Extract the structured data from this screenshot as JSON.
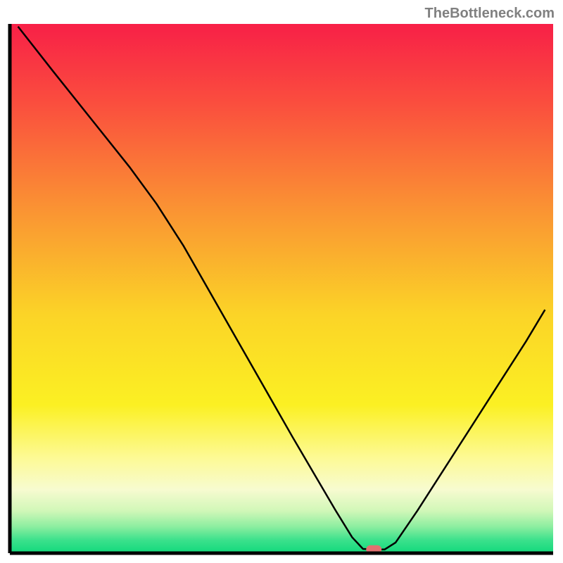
{
  "watermark": "TheBottleneck.com",
  "chart_data": {
    "type": "line",
    "title": "",
    "xlabel": "",
    "ylabel": "",
    "x_range": [
      0,
      100
    ],
    "y_range": [
      0,
      100
    ],
    "curve_description": "V-shaped bottleneck curve descending from top-left to minimum near x=67 then rising to right edge",
    "curve": [
      {
        "x": 1.5,
        "y": 99.5
      },
      {
        "x": 8,
        "y": 91
      },
      {
        "x": 15,
        "y": 82
      },
      {
        "x": 22,
        "y": 73
      },
      {
        "x": 27,
        "y": 66
      },
      {
        "x": 32,
        "y": 58
      },
      {
        "x": 37,
        "y": 49
      },
      {
        "x": 42,
        "y": 40
      },
      {
        "x": 47,
        "y": 31
      },
      {
        "x": 52,
        "y": 22
      },
      {
        "x": 56,
        "y": 15
      },
      {
        "x": 60,
        "y": 8
      },
      {
        "x": 63,
        "y": 3
      },
      {
        "x": 65,
        "y": 0.8
      },
      {
        "x": 67,
        "y": 0.7
      },
      {
        "x": 69,
        "y": 0.7
      },
      {
        "x": 71,
        "y": 2
      },
      {
        "x": 75,
        "y": 8
      },
      {
        "x": 80,
        "y": 16
      },
      {
        "x": 85,
        "y": 24
      },
      {
        "x": 90,
        "y": 32
      },
      {
        "x": 95,
        "y": 40
      },
      {
        "x": 98.5,
        "y": 46
      }
    ],
    "minimum_marker": {
      "x": 67,
      "y": 0.7
    },
    "gradient_colors": [
      {
        "offset": 0,
        "color": "#f82047"
      },
      {
        "offset": 0.15,
        "color": "#fa4e3e"
      },
      {
        "offset": 0.35,
        "color": "#fa9333"
      },
      {
        "offset": 0.55,
        "color": "#fbd427"
      },
      {
        "offset": 0.72,
        "color": "#fbf023"
      },
      {
        "offset": 0.82,
        "color": "#fdfa95"
      },
      {
        "offset": 0.88,
        "color": "#f7fbd0"
      },
      {
        "offset": 0.92,
        "color": "#d1f7b8"
      },
      {
        "offset": 0.95,
        "color": "#8ceea0"
      },
      {
        "offset": 0.975,
        "color": "#3ce18c"
      },
      {
        "offset": 1.0,
        "color": "#11d97c"
      }
    ],
    "marker_color": "#e27070",
    "axes_color": "#000000"
  }
}
